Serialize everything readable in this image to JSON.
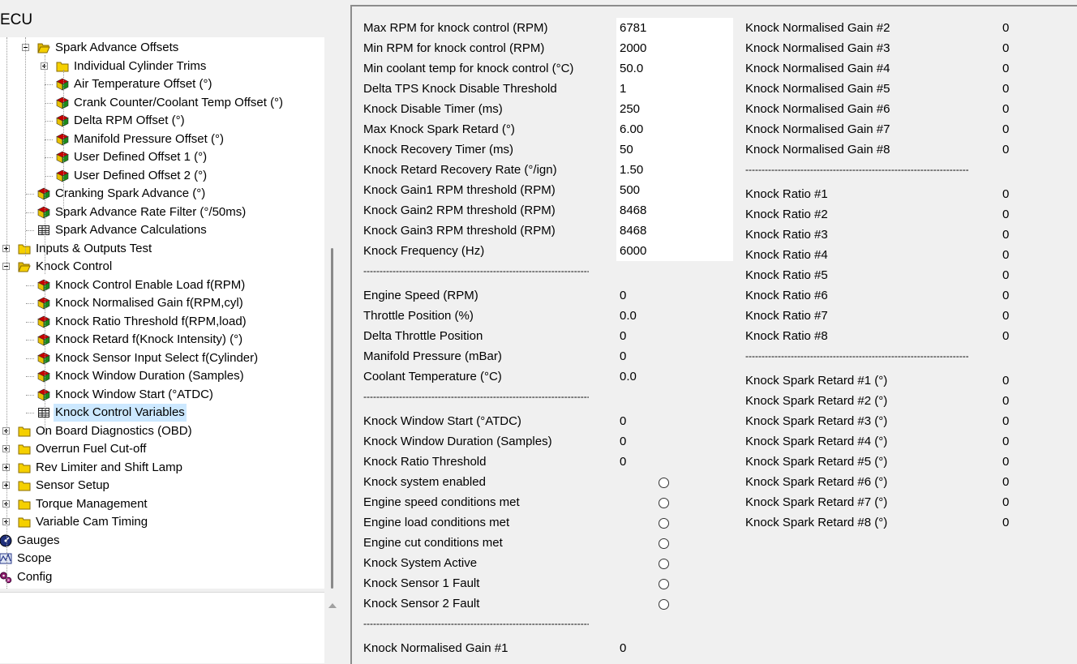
{
  "left_panel": {
    "title": "ECU",
    "tree": [
      {
        "label": "Spark Advance Offsets",
        "icon": "folder-open-icon",
        "expander": "minus",
        "indent": 1
      },
      {
        "label": "Individual Cylinder Trims",
        "icon": "folder-icon",
        "expander": "plus",
        "indent": 2
      },
      {
        "label": "Air Temperature Offset (°)",
        "icon": "cube-icon",
        "expander": "",
        "indent": 2
      },
      {
        "label": "Crank Counter/Coolant Temp Offset (°)",
        "icon": "cube-icon",
        "expander": "",
        "indent": 2
      },
      {
        "label": "Delta RPM Offset (°)",
        "icon": "cube-icon",
        "expander": "",
        "indent": 2
      },
      {
        "label": "Manifold Pressure Offset (°)",
        "icon": "cube-icon",
        "expander": "",
        "indent": 2
      },
      {
        "label": "User Defined Offset 1 (°)",
        "icon": "cube-icon",
        "expander": "",
        "indent": 2
      },
      {
        "label": "User Defined Offset 2 (°)",
        "icon": "cube-icon",
        "expander": "",
        "indent": 2
      },
      {
        "label": "Cranking Spark Advance (°)",
        "icon": "cube-icon",
        "expander": "",
        "indent": 1
      },
      {
        "label": "Spark Advance Rate Filter (°/50ms)",
        "icon": "cube-icon",
        "expander": "",
        "indent": 1
      },
      {
        "label": "Spark Advance Calculations",
        "icon": "table-icon",
        "expander": "",
        "indent": 1
      },
      {
        "label": "Inputs & Outputs Test",
        "icon": "folder-icon",
        "expander": "plus",
        "indent": 0
      },
      {
        "label": "Knock Control",
        "icon": "folder-open-icon",
        "expander": "minus",
        "indent": 0
      },
      {
        "label": "Knock Control Enable Load f(RPM)",
        "icon": "cube-icon",
        "expander": "",
        "indent": 1
      },
      {
        "label": "Knock Normalised Gain f(RPM,cyl)",
        "icon": "cube-icon",
        "expander": "",
        "indent": 1
      },
      {
        "label": "Knock Ratio Threshold f(RPM,load)",
        "icon": "cube-icon",
        "expander": "",
        "indent": 1
      },
      {
        "label": "Knock Retard f(Knock Intensity) (°)",
        "icon": "cube-icon",
        "expander": "",
        "indent": 1
      },
      {
        "label": "Knock Sensor Input Select f(Cylinder)",
        "icon": "cube-icon",
        "expander": "",
        "indent": 1
      },
      {
        "label": "Knock Window Duration (Samples)",
        "icon": "cube-icon",
        "expander": "",
        "indent": 1
      },
      {
        "label": "Knock Window Start (°ATDC)",
        "icon": "cube-icon",
        "expander": "",
        "indent": 1
      },
      {
        "label": "Knock Control Variables",
        "icon": "table-icon",
        "expander": "",
        "indent": 1,
        "selected": true
      },
      {
        "label": "On Board Diagnostics (OBD)",
        "icon": "folder-icon",
        "expander": "plus",
        "indent": 0
      },
      {
        "label": "Overrun Fuel Cut-off",
        "icon": "folder-icon",
        "expander": "plus",
        "indent": 0
      },
      {
        "label": "Rev Limiter and Shift Lamp",
        "icon": "folder-icon",
        "expander": "plus",
        "indent": 0
      },
      {
        "label": "Sensor Setup",
        "icon": "folder-icon",
        "expander": "plus",
        "indent": 0
      },
      {
        "label": "Torque Management",
        "icon": "folder-icon",
        "expander": "plus",
        "indent": 0
      },
      {
        "label": "Variable Cam Timing",
        "icon": "folder-icon",
        "expander": "plus",
        "indent": 0
      },
      {
        "label": "Gauges",
        "icon": "gauge-icon",
        "expander": "plus",
        "indent": -1
      },
      {
        "label": "Scope",
        "icon": "scope-icon",
        "expander": "plus",
        "indent": -1
      },
      {
        "label": "Config",
        "icon": "gears-icon",
        "expander": "",
        "indent": -1
      }
    ]
  },
  "settings": [
    {
      "label": "Max RPM for knock control (RPM)",
      "value": "6781"
    },
    {
      "label": "Min RPM for knock control (RPM)",
      "value": "2000"
    },
    {
      "label": "Min coolant temp for knock control (°C)",
      "value": "50.0"
    },
    {
      "label": "Delta TPS Knock Disable Threshold",
      "value": "1"
    },
    {
      "label": "Knock Disable Timer (ms)",
      "value": "250"
    },
    {
      "label": "Max Knock Spark Retard (°)",
      "value": "6.00"
    },
    {
      "label": "Knock Recovery Timer (ms)",
      "value": "50"
    },
    {
      "label": "Knock Retard Recovery Rate (°/ign)",
      "value": "1.50"
    },
    {
      "label": "Knock Gain1 RPM threshold (RPM)",
      "value": "500"
    },
    {
      "label": "Knock Gain2 RPM threshold (RPM)",
      "value": "8468"
    },
    {
      "label": "Knock Gain3 RPM threshold (RPM)",
      "value": "8468"
    },
    {
      "label": "Knock Frequency (Hz)",
      "value": "6000"
    }
  ],
  "separator": "-----------------------------------------------------------------------",
  "engine_values": [
    {
      "label": "Engine Speed (RPM)",
      "value": "0"
    },
    {
      "label": "Throttle Position (%)",
      "value": "0.0"
    },
    {
      "label": "Delta Throttle Position",
      "value": "0"
    },
    {
      "label": "Manifold Pressure (mBar)",
      "value": "0"
    },
    {
      "label": "Coolant Temperature (°C)",
      "value": "0.0"
    }
  ],
  "knock_window_values": [
    {
      "label": "Knock Window Start (°ATDC)",
      "value": "0"
    },
    {
      "label": "Knock Window Duration (Samples)",
      "value": "0"
    },
    {
      "label": "Knock Ratio Threshold",
      "value": "0"
    }
  ],
  "status_flags": [
    {
      "label": "Knock system enabled"
    },
    {
      "label": "Engine speed conditions met"
    },
    {
      "label": "Engine load conditions met"
    },
    {
      "label": "Engine cut conditions met"
    },
    {
      "label": "Knock System Active"
    },
    {
      "label": "Knock Sensor 1 Fault"
    },
    {
      "label": "Knock Sensor 2 Fault"
    }
  ],
  "gain_bottom": {
    "label": "Knock Normalised Gain #1",
    "value": "0"
  },
  "gains": [
    {
      "label": "Knock Normalised Gain #2",
      "value": "0"
    },
    {
      "label": "Knock Normalised Gain #3",
      "value": "0"
    },
    {
      "label": "Knock Normalised Gain #4",
      "value": "0"
    },
    {
      "label": "Knock Normalised Gain #5",
      "value": "0"
    },
    {
      "label": "Knock Normalised Gain #6",
      "value": "0"
    },
    {
      "label": "Knock Normalised Gain #7",
      "value": "0"
    },
    {
      "label": "Knock Normalised Gain #8",
      "value": "0"
    }
  ],
  "ratios": [
    {
      "label": "Knock Ratio #1",
      "value": "0"
    },
    {
      "label": "Knock Ratio #2",
      "value": "0"
    },
    {
      "label": "Knock Ratio #3",
      "value": "0"
    },
    {
      "label": "Knock Ratio #4",
      "value": "0"
    },
    {
      "label": "Knock Ratio #5",
      "value": "0"
    },
    {
      "label": "Knock Ratio #6",
      "value": "0"
    },
    {
      "label": "Knock Ratio #7",
      "value": "0"
    },
    {
      "label": "Knock Ratio #8",
      "value": "0"
    }
  ],
  "retards": [
    {
      "label": "Knock Spark Retard #1 (°)",
      "value": "0"
    },
    {
      "label": "Knock Spark Retard #2 (°)",
      "value": "0"
    },
    {
      "label": "Knock Spark Retard #3 (°)",
      "value": "0"
    },
    {
      "label": "Knock Spark Retard #4 (°)",
      "value": "0"
    },
    {
      "label": "Knock Spark Retard #5 (°)",
      "value": "0"
    },
    {
      "label": "Knock Spark Retard #6 (°)",
      "value": "0"
    },
    {
      "label": "Knock Spark Retard #7 (°)",
      "value": "0"
    },
    {
      "label": "Knock Spark Retard #8 (°)",
      "value": "0"
    }
  ],
  "colors": {
    "folder": "#f5d000",
    "cube_red": "#c80000",
    "cube_green": "#1a8a1a",
    "selection": "#cce8ff"
  }
}
